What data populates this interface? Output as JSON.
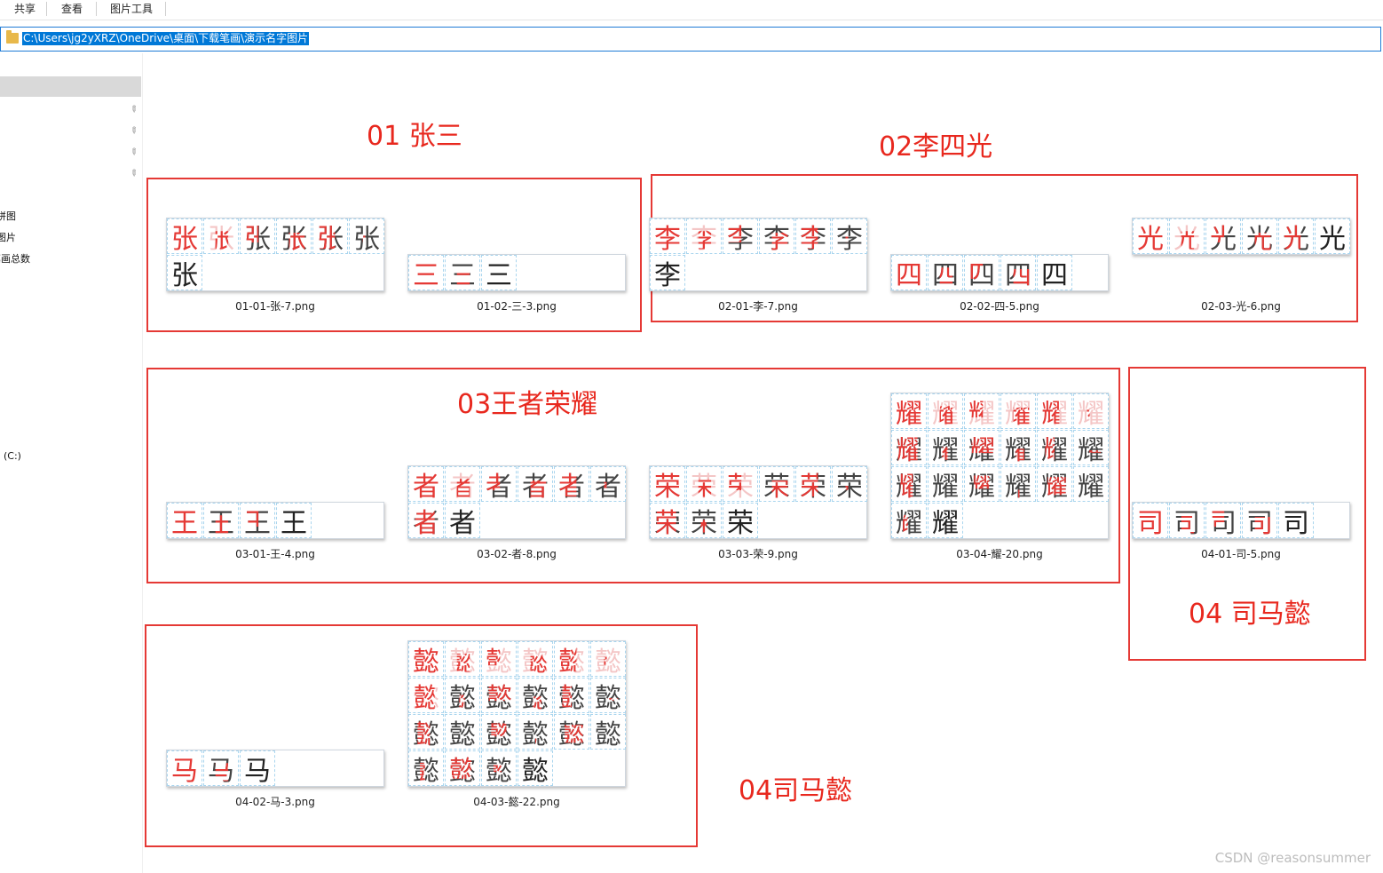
{
  "ribbon": {
    "tabs": [
      "共享",
      "查看",
      "图片工具"
    ]
  },
  "address": {
    "path": "C:\\Users\\jg2yXRZ\\OneDrive\\桌面\\下载笔画\\演示名字图片"
  },
  "nav": {
    "items": [
      "拼图",
      "图片",
      "笔画总数",
      "(C:)"
    ]
  },
  "groups": [
    {
      "title": "01 张三"
    },
    {
      "title": "02李四光"
    },
    {
      "title": "03王者荣耀"
    },
    {
      "title": "04 司马懿"
    },
    {
      "title": "04司马懿"
    }
  ],
  "files": [
    {
      "name": "01-01-张-7.png",
      "char": "张",
      "strokes": 7
    },
    {
      "name": "01-02-三-3.png",
      "char": "三",
      "strokes": 3
    },
    {
      "name": "02-01-李-7.png",
      "char": "李",
      "strokes": 7
    },
    {
      "name": "02-02-四-5.png",
      "char": "四",
      "strokes": 5
    },
    {
      "name": "02-03-光-6.png",
      "char": "光",
      "strokes": 6
    },
    {
      "name": "03-01-王-4.png",
      "char": "王",
      "strokes": 4
    },
    {
      "name": "03-02-者-8.png",
      "char": "者",
      "strokes": 8
    },
    {
      "name": "03-03-荣-9.png",
      "char": "荣",
      "strokes": 9
    },
    {
      "name": "03-04-耀-20.png",
      "char": "耀",
      "strokes": 20
    },
    {
      "name": "04-01-司-5.png",
      "char": "司",
      "strokes": 5
    },
    {
      "name": "04-02-马-3.png",
      "char": "马",
      "strokes": 3
    },
    {
      "name": "04-03-懿-22.png",
      "char": "懿",
      "strokes": 22
    }
  ],
  "watermark": "CSDN @reasonsummer",
  "colors": {
    "annotation": "#e53935",
    "address_highlight": "#0078d7"
  }
}
